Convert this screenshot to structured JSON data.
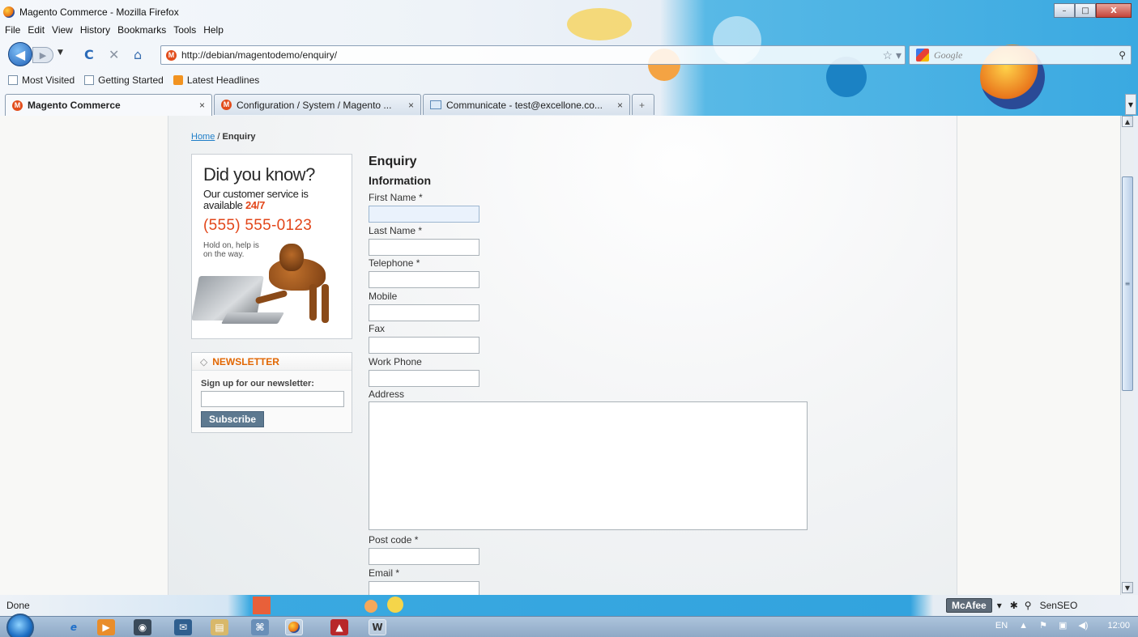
{
  "window": {
    "title": "Magento Commerce - Mozilla Firefox",
    "controls": {
      "minimize": "–",
      "maximize": "□",
      "close": "X"
    }
  },
  "menubar": [
    "File",
    "Edit",
    "View",
    "History",
    "Bookmarks",
    "Tools",
    "Help"
  ],
  "navigation": {
    "url": "http://debian/magentodemo/enquiry/",
    "search_placeholder": "Google"
  },
  "bookmarks": [
    "Most Visited",
    "Getting Started",
    "Latest Headlines"
  ],
  "tabs": [
    {
      "label": "Magento Commerce",
      "active": true
    },
    {
      "label": "Configuration / System / Magento ...",
      "active": false
    },
    {
      "label": "Communicate - test@excellone.co...",
      "active": false
    }
  ],
  "page": {
    "breadcrumb": {
      "home": "Home",
      "separator": "/",
      "current": "Enquiry"
    },
    "promo": {
      "heading": "Did you know?",
      "line1": "Our customer service is available ",
      "highlight": "24/7",
      "phone": "(555) 555-0123",
      "tagline": "Hold on, help is on the way."
    },
    "newsletter": {
      "title": "NEWSLETTER",
      "label": "Sign up for our newsletter:",
      "button": "Subscribe"
    },
    "form": {
      "title": "Enquiry",
      "section": "Information",
      "fields": [
        {
          "label": "First Name *",
          "value": ""
        },
        {
          "label": "Last Name *",
          "value": ""
        },
        {
          "label": "Telephone *",
          "value": ""
        },
        {
          "label": "Mobile",
          "value": ""
        },
        {
          "label": "Fax",
          "value": ""
        },
        {
          "label": "Work Phone",
          "value": ""
        }
      ],
      "address_label": "Address",
      "tail_fields": [
        {
          "label": "Post code *",
          "value": ""
        },
        {
          "label": "Email *",
          "value": ""
        }
      ]
    }
  },
  "statusbar": {
    "status": "Done",
    "mcafee": "McAfee",
    "senseo": "SenSEO"
  },
  "taskbar": {
    "language": "EN",
    "clock": "12:00"
  },
  "colors": {
    "accent_orange": "#e2461a",
    "newsletter_orange": "#e26703",
    "link_blue": "#1e7ec8",
    "subscribe_bg": "#5d7990",
    "persona_blue": "#3aa9e1"
  }
}
